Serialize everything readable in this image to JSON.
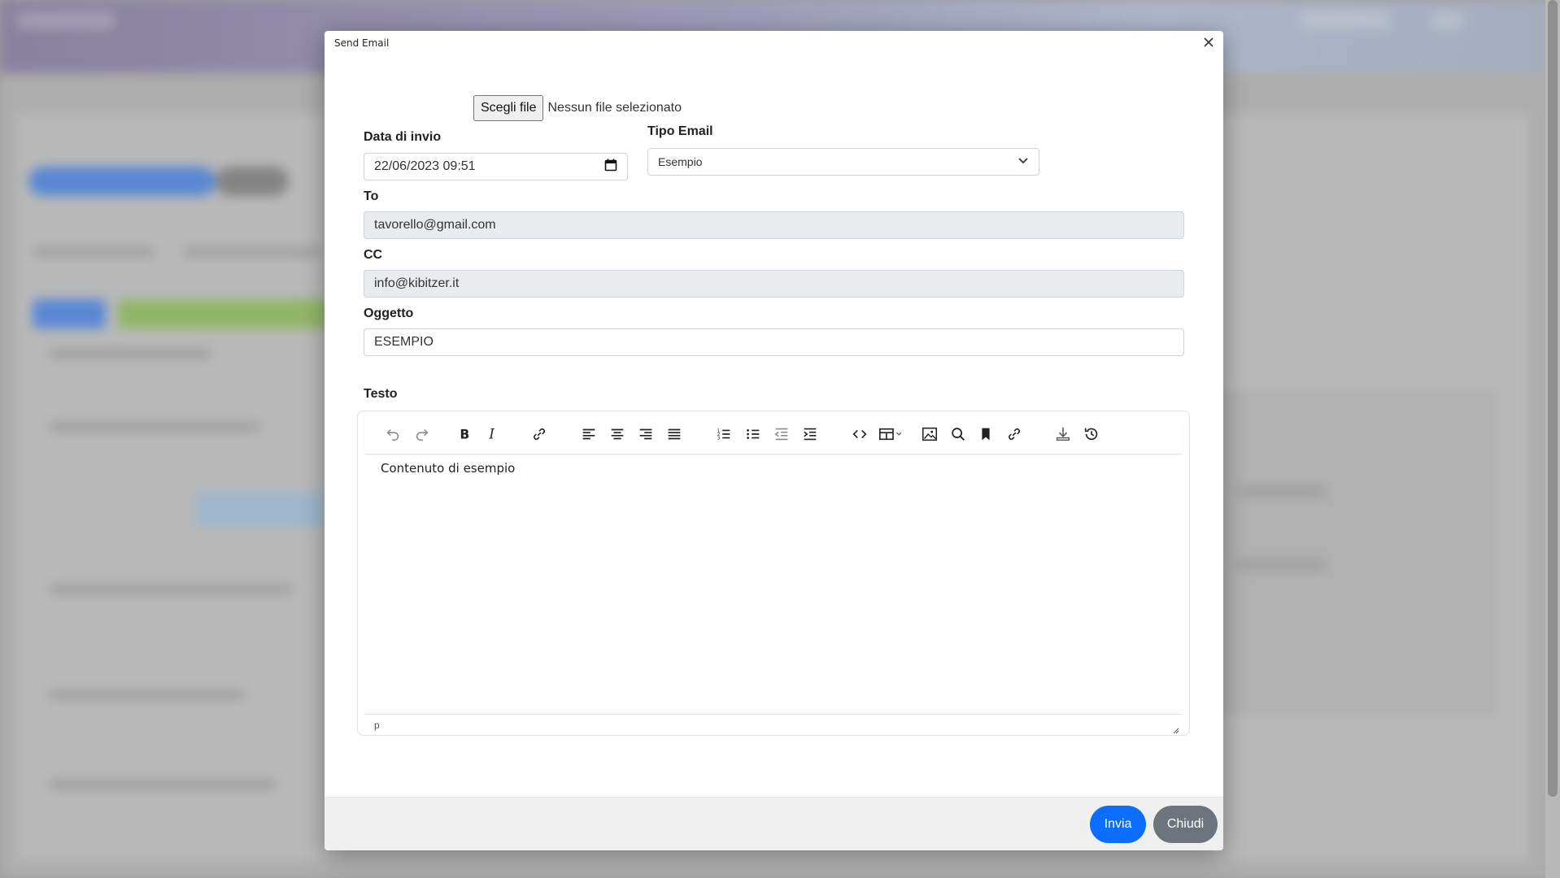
{
  "modal": {
    "title": "Send Email"
  },
  "attachment": {
    "button_label": "Scegli file",
    "status_text": "Nessun file selezionato"
  },
  "send_date": {
    "label": "Data di invio",
    "value": "22/06/2023 09:51"
  },
  "email_type": {
    "label": "Tipo Email",
    "selected": "Esempio"
  },
  "to": {
    "label": "To",
    "value": "tavorello@gmail.com"
  },
  "cc": {
    "label": "CC",
    "value": "info@kibitzer.it"
  },
  "subject": {
    "label": "Oggetto",
    "value": "ESEMPIO"
  },
  "body": {
    "label": "Testo",
    "content": "Contenuto di esempio",
    "status_path": "p",
    "toolbar": [
      "undo-icon",
      "redo-icon",
      "bold-icon",
      "italic-icon",
      "link-icon",
      "align-left-icon",
      "align-center-icon",
      "align-right-icon",
      "align-justify-icon",
      "numbered-list-icon",
      "bullet-list-icon",
      "outdent-icon",
      "indent-icon",
      "code-icon",
      "table-icon",
      "image-icon",
      "search-icon",
      "bookmark-icon",
      "unlink-icon",
      "download-icon",
      "history-icon"
    ]
  },
  "footer": {
    "send_label": "Invia",
    "close_label": "Chiudi"
  },
  "colors": {
    "primary": "#0d6efd",
    "secondary": "#6c757d"
  }
}
